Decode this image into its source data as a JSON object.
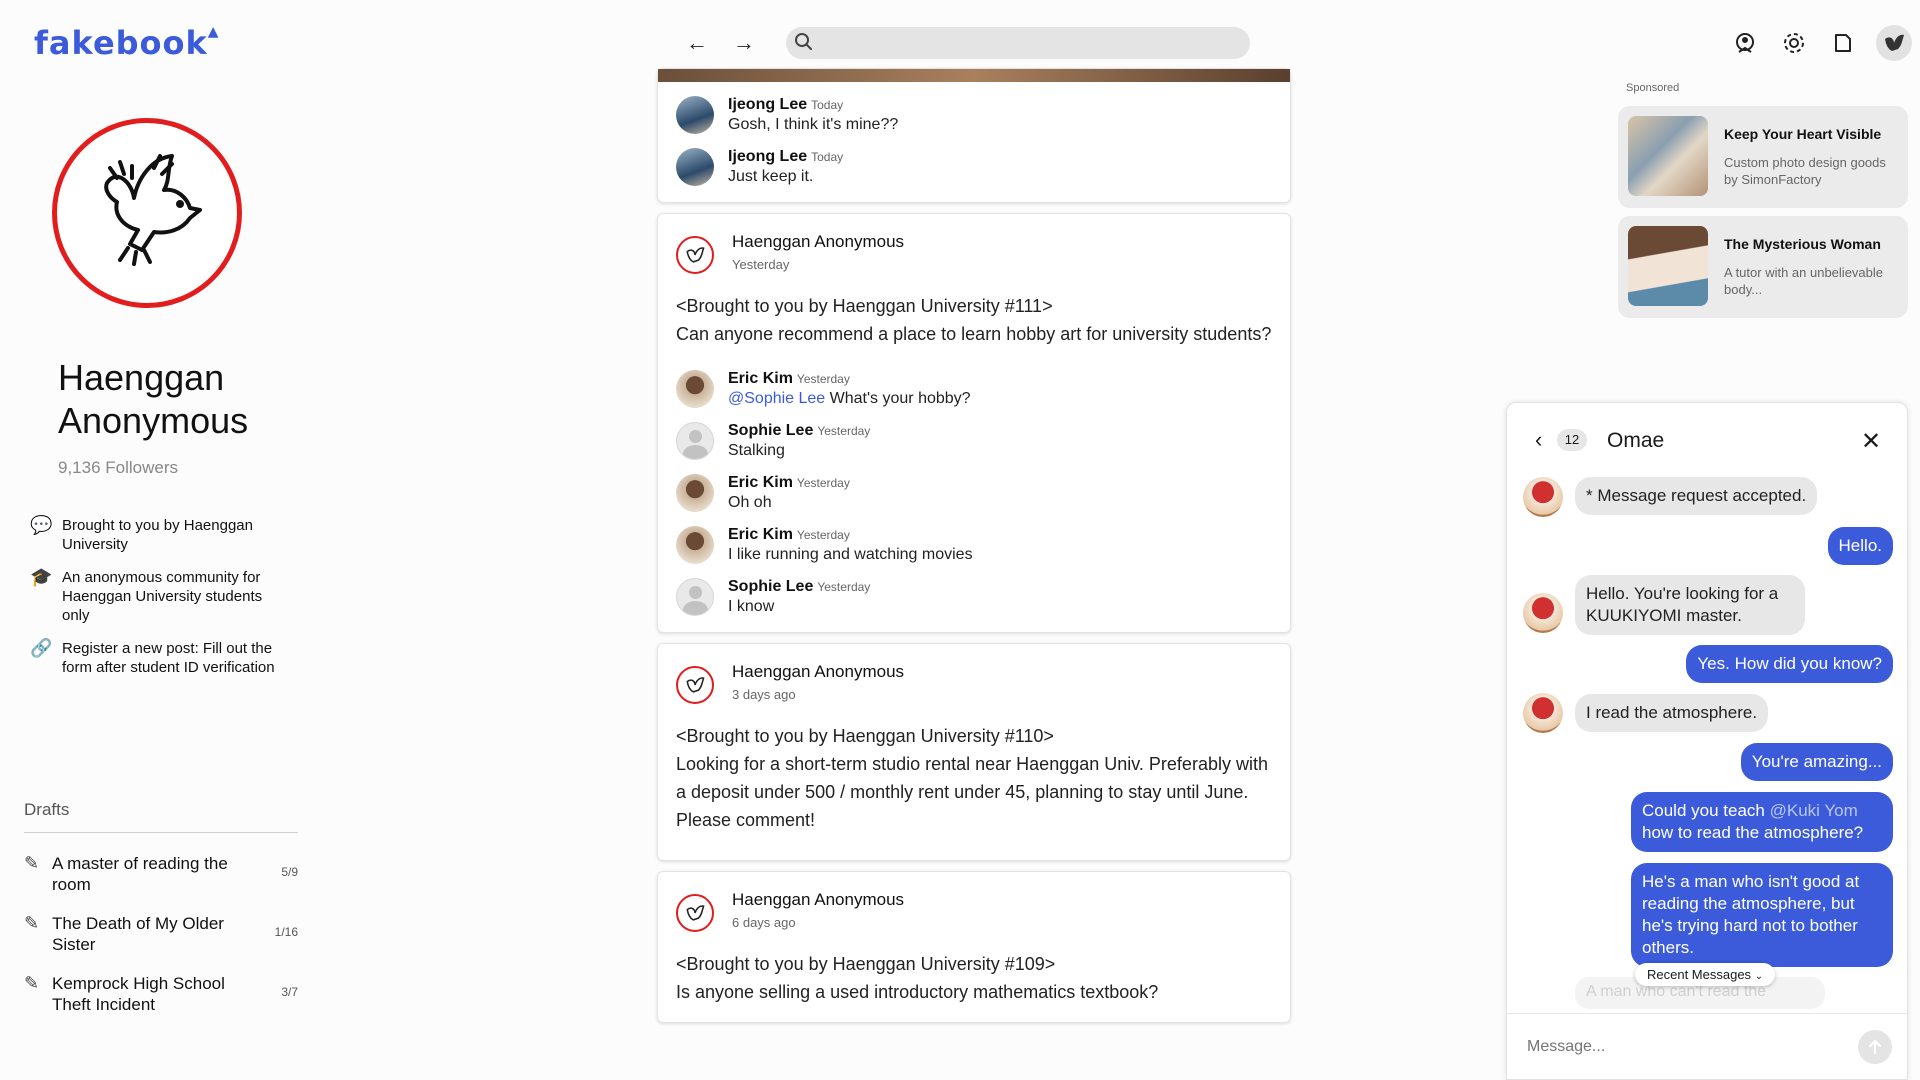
{
  "app": {
    "logo_text": "fakebook"
  },
  "search": {
    "placeholder": ""
  },
  "profile": {
    "name": "Haenggan Anonymous",
    "followers": "9,136 Followers",
    "about": [
      {
        "icon": "speech-bubble-icon",
        "text": "Brought to you by Haenggan University"
      },
      {
        "icon": "graduation-cap-icon",
        "text": "An anonymous community for Haenggan University students only"
      },
      {
        "icon": "link-icon",
        "text": "Register a new post: Fill out the form after student ID verification"
      }
    ]
  },
  "drafts": {
    "title": "Drafts",
    "items": [
      {
        "title": "A master of reading the room",
        "count": "5/9"
      },
      {
        "title": "The Death of My Older Sister",
        "count": "1/16"
      },
      {
        "title": "Kemprock High School Theft Incident",
        "count": "3/7"
      }
    ]
  },
  "feed": {
    "top_comments": [
      {
        "name": "Ijeong Lee",
        "time": "Today",
        "text": "Gosh, I think it's mine??"
      },
      {
        "name": "Ijeong Lee",
        "time": "Today",
        "text": "Just keep it."
      }
    ],
    "posts": [
      {
        "author": "Haenggan Anonymous",
        "time": "Yesterday",
        "body": "<Brought to you by Haenggan University #111>\nCan anyone recommend a place to learn hobby art for university students?",
        "comments": [
          {
            "name": "Eric Kim",
            "time": "Yesterday",
            "mention": "@Sophie Lee",
            "text": " What's your hobby?"
          },
          {
            "name": "Sophie Lee",
            "time": "Yesterday",
            "mention": "",
            "text": "Stalking"
          },
          {
            "name": "Eric Kim",
            "time": "Yesterday",
            "mention": "",
            "text": "Oh oh"
          },
          {
            "name": "Eric Kim",
            "time": "Yesterday",
            "mention": "",
            "text": "I like running and watching movies"
          },
          {
            "name": "Sophie Lee",
            "time": "Yesterday",
            "mention": "",
            "text": "I know"
          }
        ]
      },
      {
        "author": "Haenggan Anonymous",
        "time": "3 days ago",
        "body": "<Brought to you by Haenggan University #110>\nLooking for a short-term studio rental near Haenggan Univ. Preferably with a deposit under 500 / monthly rent under 45, planning to stay until June. Please comment!"
      },
      {
        "author": "Haenggan Anonymous",
        "time": "6 days ago",
        "body": "<Brought to you by Haenggan University #109>\nIs anyone selling a used introductory mathematics textbook?"
      }
    ]
  },
  "sponsored": {
    "label": "Sponsored",
    "ads": [
      {
        "title": "Keep Your Heart Visible",
        "desc": "Custom photo design goods by SimonFactory"
      },
      {
        "title": "The Mysterious Woman",
        "desc": "A tutor with an unbelievable body..."
      }
    ]
  },
  "chat": {
    "back_count": "12",
    "title": "Omae",
    "messages": [
      {
        "dir": "in",
        "text": "* Message request accepted."
      },
      {
        "dir": "out",
        "text": "Hello."
      },
      {
        "dir": "in",
        "text": "Hello. You're looking for a KUUKIYOMI master."
      },
      {
        "dir": "out",
        "text": "Yes. How did you know?"
      },
      {
        "dir": "in",
        "text": "I read the atmosphere."
      },
      {
        "dir": "out",
        "text": "You're amazing..."
      },
      {
        "dir": "out",
        "pre": "Could you teach ",
        "mention": "@Kuki Yom",
        "post": " how to read the atmosphere?"
      },
      {
        "dir": "out",
        "text": "He's a man who isn't good at reading the atmosphere, but he's trying hard not to bother others."
      }
    ],
    "faded_message": "A man who can't read the",
    "recent_label": "Recent Messages",
    "input_placeholder": "Message..."
  },
  "colors": {
    "brand": "#3b5bdb",
    "accent_red": "#e11d1d"
  }
}
